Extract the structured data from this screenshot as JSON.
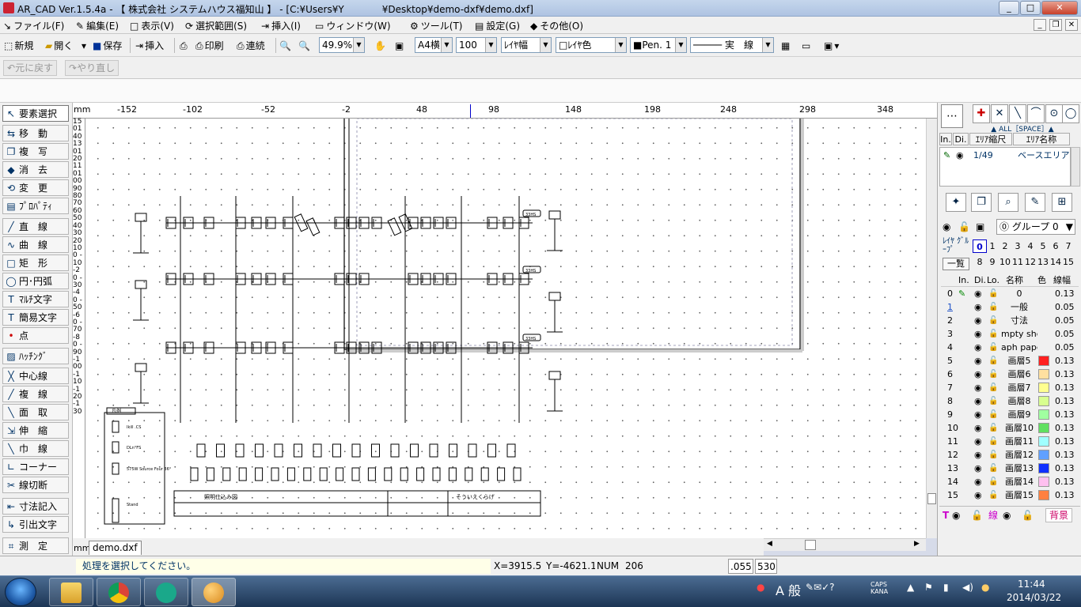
{
  "window": {
    "title": "AR_CAD Ver.1.5.4a - 【 株式会社 システムハウス福知山 】 - [C:¥Users¥Y　　　　¥Desktop¥demo-dxf¥demo.dxf]",
    "btn_min": "_",
    "btn_max": "□",
    "btn_close": "✕"
  },
  "menu": [
    {
      "label": "ファイル(F)",
      "icon": "↘"
    },
    {
      "label": "編集(E)",
      "icon": "✎"
    },
    {
      "label": "表示(V)",
      "icon": "□"
    },
    {
      "label": "選択範囲(S)",
      "icon": "⟳"
    },
    {
      "label": "挿入(I)",
      "icon": "⇥"
    },
    {
      "label": "ウィンドウ(W)",
      "icon": "▭"
    },
    {
      "label": "ツール(T)",
      "icon": "⚙"
    },
    {
      "label": "設定(G)",
      "icon": "▤"
    },
    {
      "label": "その他(O)",
      "icon": "◆"
    }
  ],
  "mdi": {
    "min": "_",
    "restore": "❐",
    "close": "✕"
  },
  "toolbar": {
    "new": "新規",
    "open": "開く",
    "save": "保存",
    "insert": "挿入",
    "print": "印刷",
    "continuous": "連続",
    "zoom": "49.9%",
    "paper": "A4横",
    "scale": "100",
    "layer_width": "ﾚｲﾔ幅",
    "layer_color": "ﾚｲﾔ色",
    "pen": "Pen. 1",
    "linetype": "実　線"
  },
  "toolbar2": {
    "undo": "元に戻す",
    "redo": "やり直し"
  },
  "left_tools": [
    "要素選択",
    "移　動",
    "複　写",
    "消　去",
    "変　更",
    "ﾌﾟﾛﾊﾟﾃｨ",
    "直　線",
    "曲　線",
    "矩　形",
    "円･円弧",
    "ﾏﾙﾁ文字",
    "簡易文字",
    "点",
    "ﾊｯﾁﾝｸﾞ",
    "中心線",
    "複　線",
    "面　取",
    "伸　縮",
    "巾　線",
    "コーナー",
    "線切断",
    "寸法記入",
    "引出文字",
    "測　定"
  ],
  "ruler_unit": "mm",
  "ruler_h": [
    "-152",
    "-102",
    "-52",
    "-2",
    "48",
    "98",
    "148",
    "198",
    "248",
    "298",
    "348"
  ],
  "ruler_v": "150140130120110100 90 80 70 60 50 40 30 20 10 0 -10 -20 -30 -40 -50 -60 -70 -80 -90-100-110-120-130",
  "drawing": {
    "tag": "33HS",
    "legend_title": "凡例",
    "legend_items": [
      "Ikill .CS",
      "DLn°FS",
      "575W Source Four 36°",
      "Stand"
    ],
    "titleblock": [
      "照明仕込み図",
      "",
      "そういえくらげ"
    ]
  },
  "doc_tab": "demo.dxf",
  "snap_label": "▲ ALL［SPACE］▲",
  "area": {
    "headers": [
      "In.",
      "Di.",
      "ｴﾘｱ縮尺",
      "ｴﾘｱ名称"
    ],
    "scale": "1/49",
    "name": "ベースエリア"
  },
  "group": {
    "label": "グループ 0"
  },
  "layer_group": {
    "label": "ﾚｲﾔ ｸﾞﾙｰﾌﾟ",
    "list_btn": "一覧",
    "nums_top": [
      "0",
      "1",
      "2",
      "3",
      "4",
      "5",
      "6",
      "7"
    ],
    "nums_bottom": [
      "8",
      "9",
      "10",
      "11",
      "12",
      "13",
      "14",
      "15"
    ]
  },
  "layer_headers": [
    "In.",
    "Di.",
    "Lo.",
    "名称",
    "色",
    "線幅"
  ],
  "layers": [
    {
      "no": "0",
      "name": "0",
      "width": "0.13",
      "color": ""
    },
    {
      "no": "1",
      "name": "一般",
      "width": "0.05",
      "color": ""
    },
    {
      "no": "2",
      "name": "寸法",
      "width": "0.05",
      "color": ""
    },
    {
      "no": "3",
      "name": "mpty she",
      "width": "0.05",
      "color": ""
    },
    {
      "no": "4",
      "name": "aph pape",
      "width": "0.05",
      "color": ""
    },
    {
      "no": "5",
      "name": "画層5",
      "width": "0.13",
      "color": "#ff2020"
    },
    {
      "no": "6",
      "name": "画層6",
      "width": "0.13",
      "color": "#ffe0a0"
    },
    {
      "no": "7",
      "name": "画層7",
      "width": "0.13",
      "color": "#ffff90"
    },
    {
      "no": "8",
      "name": "画層8",
      "width": "0.13",
      "color": "#d8ff90"
    },
    {
      "no": "9",
      "name": "画層9",
      "width": "0.13",
      "color": "#a0ffa0"
    },
    {
      "no": "10",
      "name": "画層10",
      "width": "0.13",
      "color": "#60e060"
    },
    {
      "no": "11",
      "name": "画層11",
      "width": "0.13",
      "color": "#a0ffff"
    },
    {
      "no": "12",
      "name": "画層12",
      "width": "0.13",
      "color": "#60a0ff"
    },
    {
      "no": "13",
      "name": "画層13",
      "width": "0.13",
      "color": "#1030ff"
    },
    {
      "no": "14",
      "name": "画層14",
      "width": "0.13",
      "color": "#ffc0f0"
    },
    {
      "no": "15",
      "name": "画層15",
      "width": "0.13",
      "color": "#ff8040"
    }
  ],
  "panel_bottom": {
    "t": "T",
    "line": "線",
    "bg": "背景"
  },
  "status": {
    "message": "処理を選択してください。",
    "x": "X=3915.5",
    "y": "Y=-4621.1",
    "num": "NUM",
    "val1": "206",
    "val2": ".055",
    "val3": "530"
  },
  "taskbar": {
    "ime": "A 般",
    "caps": "CAPS",
    "kana": "KANA",
    "time": "11:44",
    "date": "2014/03/22"
  },
  "colors": {
    "accent": "#1f5ba8",
    "layer_active": "#1a4fc7"
  }
}
